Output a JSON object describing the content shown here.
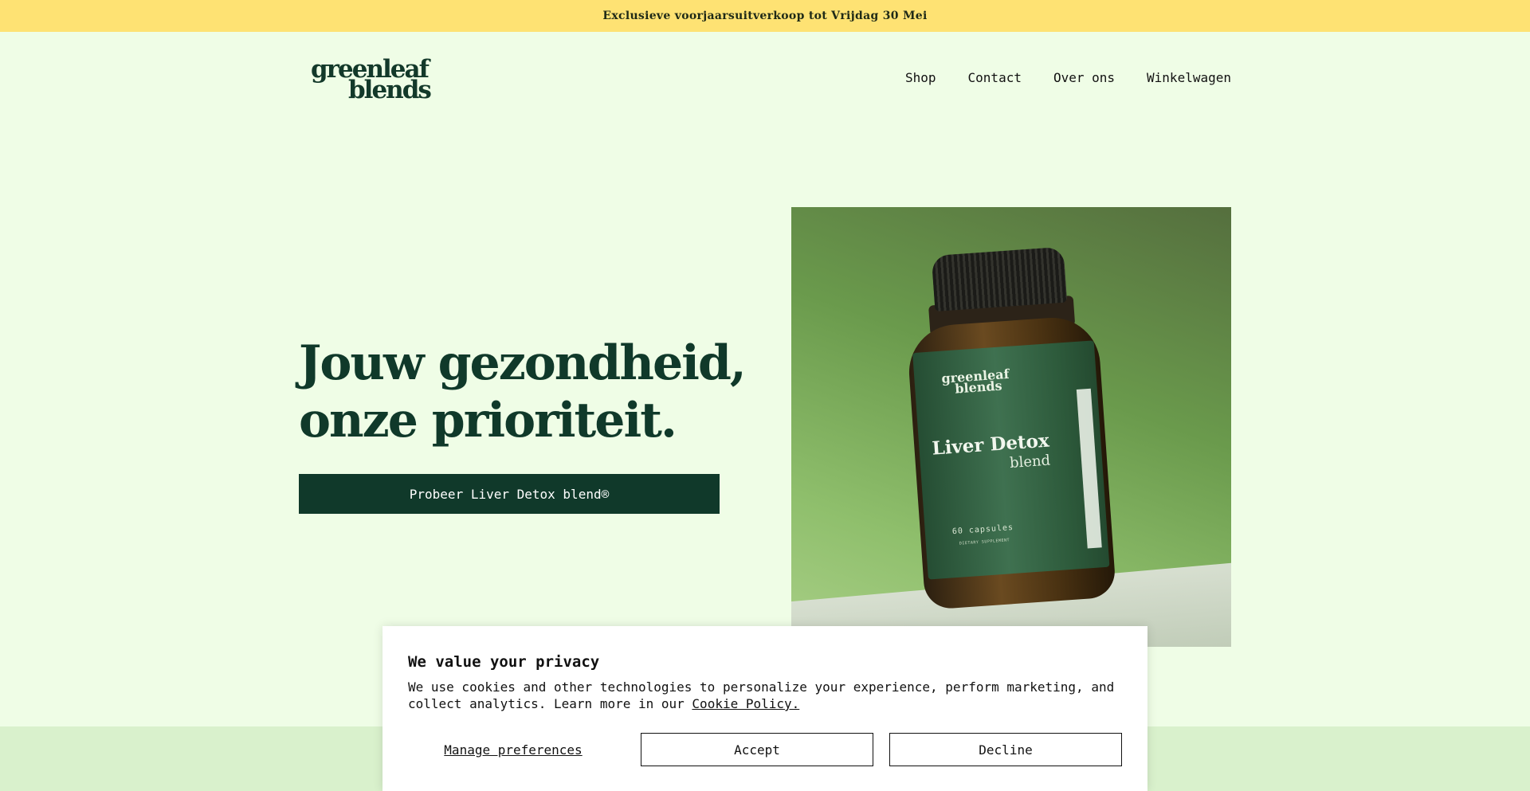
{
  "announcement": {
    "text": "Exclusieve voorjaarsuitverkoop tot Vrijdag 30 Mei"
  },
  "brand": {
    "logo_line1": "greenleaf",
    "logo_line2": "blends"
  },
  "nav": {
    "items": [
      {
        "label": "Shop"
      },
      {
        "label": "Contact"
      },
      {
        "label": "Over ons"
      },
      {
        "label": "Winkelwagen"
      }
    ]
  },
  "hero": {
    "title_line1": "Jouw gezondheid,",
    "title_line2": "onze prioriteit.",
    "cta_label": "Probeer Liver Detox blend®"
  },
  "product_image": {
    "label_logo_line1": "greenleaf",
    "label_logo_line2": "blends",
    "product_name": "Liver Detox",
    "product_sub": "blend",
    "capsules": "60 capsules",
    "supplement": "DIETARY SUPPLEMENT"
  },
  "cookie_banner": {
    "title": "We value your privacy",
    "text": "We use cookies and other technologies to personalize your experience, perform marketing, and collect analytics. Learn more in our ",
    "policy_link": "Cookie Policy.",
    "manage_label": "Manage preferences",
    "accept_label": "Accept",
    "decline_label": "Decline"
  },
  "colors": {
    "page_bg": "#effde6",
    "announcement_bg": "#fee273",
    "brand_dark_green": "#10392a",
    "bottom_band": "#d9f1cc"
  }
}
